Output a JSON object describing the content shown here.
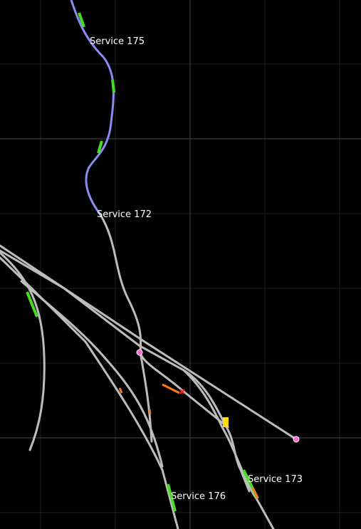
{
  "map": {
    "background": "#000000",
    "grid_color": "#2a2a2a",
    "track_color": "#bdbdbd",
    "active_route_color": "#8a8cf0",
    "occupied_color": "#44dd22",
    "warning_color": "#ff7a1a",
    "platform_color": "#ff66cc"
  },
  "services": [
    {
      "label": "Service 175"
    },
    {
      "label": "Service 172"
    },
    {
      "label": "Service 173"
    },
    {
      "label": "Service 176"
    }
  ],
  "markers": {
    "platform_a_icon": "platform-marker",
    "platform_b_icon": "platform-marker",
    "signal_icon": "stop-signal"
  }
}
